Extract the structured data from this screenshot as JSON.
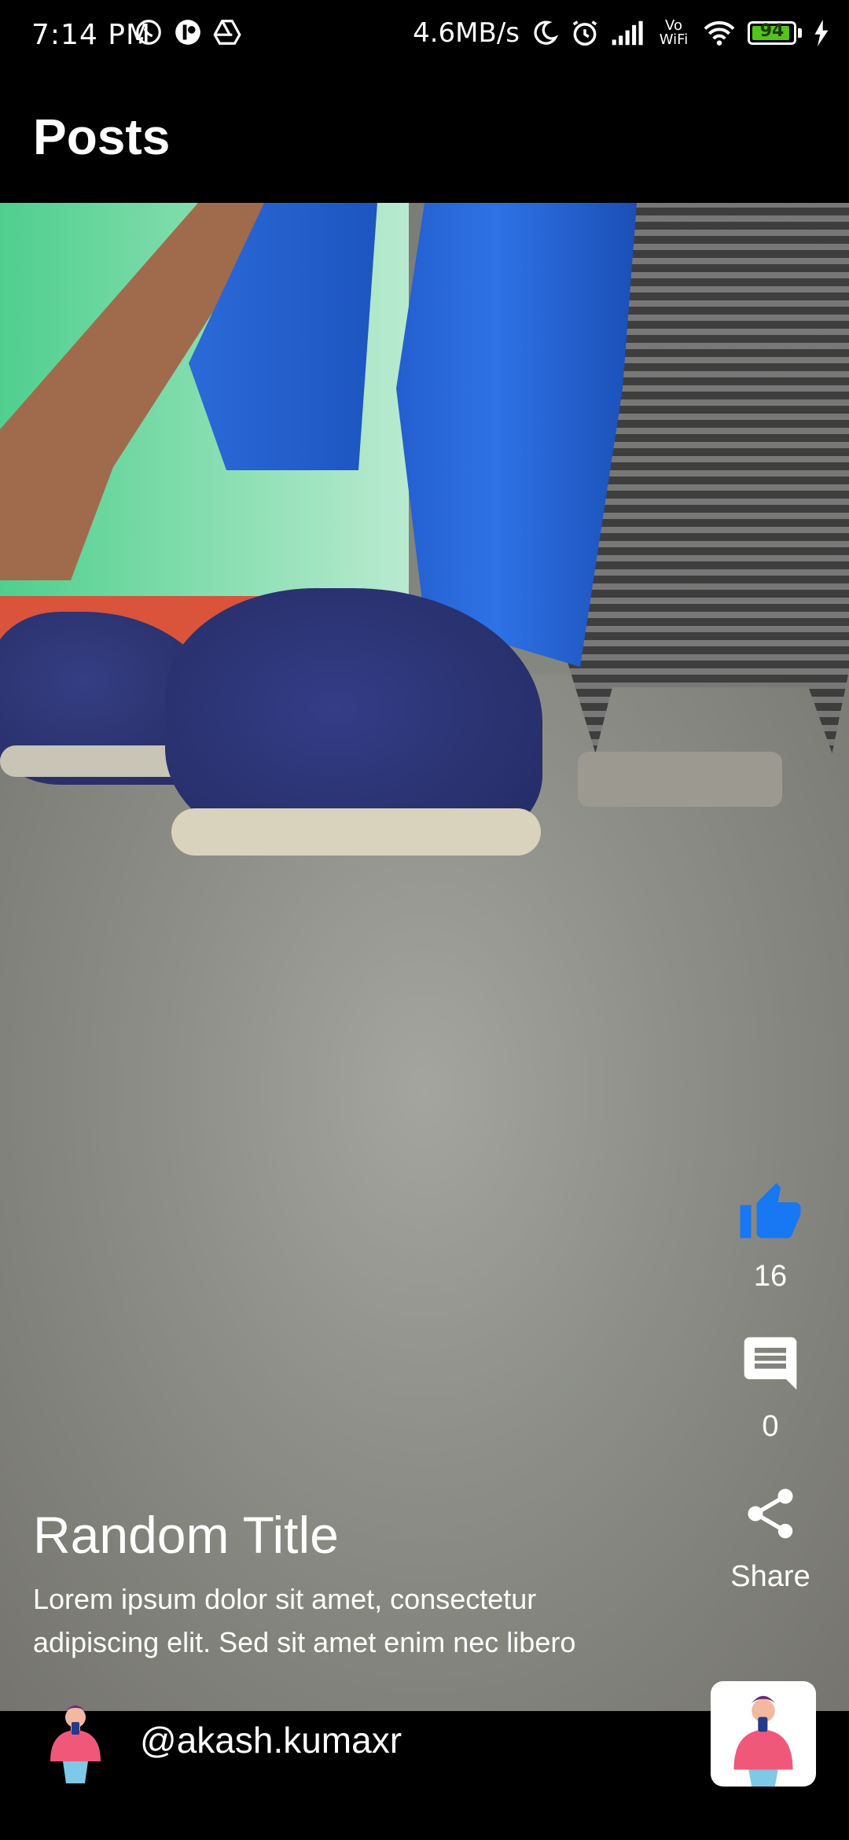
{
  "status_bar": {
    "time": "7:14 PM",
    "network_speed": "4.6MB/s",
    "wifi_label": "Vo WiFi",
    "battery": "94",
    "battery_level": 0.94,
    "battery_color": "#52c41a"
  },
  "app_bar": {
    "title": "Posts"
  },
  "actions": {
    "like_count": "16",
    "like_color": "#1877f2",
    "comment_count": "0",
    "share_label": "Share"
  },
  "post": {
    "title": "Random Title",
    "description": "Lorem ipsum dolor sit amet, consectetur adipiscing elit. Sed sit amet enim nec libero",
    "username": "@akash.kumaxr"
  }
}
